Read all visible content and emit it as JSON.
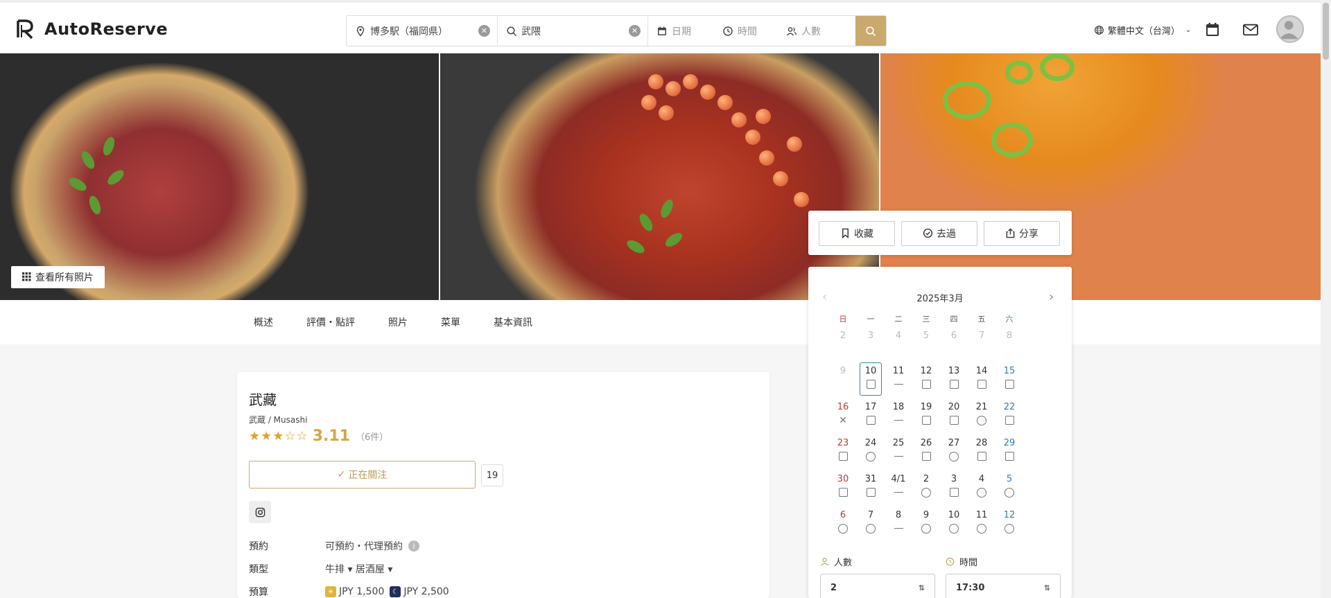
{
  "app": {
    "name": "AutoReserve"
  },
  "search": {
    "location": "博多駅（福岡県）",
    "keyword": "武隈",
    "date_placeholder": "日期",
    "time_placeholder": "時間",
    "people_placeholder": "人數"
  },
  "header": {
    "language": "繁體中文（台灣）"
  },
  "hero": {
    "view_all_photos": "查看所有照片"
  },
  "tabs": [
    {
      "label": "概述"
    },
    {
      "label": "評價・點評"
    },
    {
      "label": "照片"
    },
    {
      "label": "菜單"
    },
    {
      "label": "基本資訊"
    }
  ],
  "restaurant": {
    "name": "武藏",
    "subtitle": "武蔵 / Musashi",
    "rating": "3.11",
    "stars_filled": 3,
    "stars_total": 5,
    "review_count": "（6件）",
    "follow_label": "正在關注",
    "follow_count": "19",
    "info": [
      {
        "label": "預約",
        "value": "可預約・代理預約"
      },
      {
        "label": "類型",
        "value": "牛排 ▾ 居酒屋 ▾"
      },
      {
        "label": "預算",
        "lunch": "JPY 1,500",
        "dinner": "JPY 2,500"
      }
    ]
  },
  "actions": {
    "save": "收藏",
    "visited": "去過",
    "share": "分享"
  },
  "calendar": {
    "month_title": "2025年3月",
    "weekdays": [
      "日",
      "一",
      "二",
      "三",
      "四",
      "五",
      "六"
    ],
    "weeks": [
      [
        "2",
        "3",
        "4",
        "5",
        "6",
        "7",
        "8"
      ],
      [
        "9",
        "10",
        "11",
        "12",
        "13",
        "14",
        "15"
      ],
      [
        "16",
        "17",
        "18",
        "19",
        "20",
        "21",
        "22"
      ],
      [
        "23",
        "24",
        "25",
        "26",
        "27",
        "28",
        "29"
      ],
      [
        "30",
        "31",
        "4/1",
        "2",
        "3",
        "4",
        "5"
      ],
      [
        "6",
        "7",
        "8",
        "9",
        "10",
        "11",
        "12"
      ]
    ],
    "marks": [
      [
        "none",
        "none",
        "none",
        "none",
        "none",
        "none",
        "none"
      ],
      [
        "none",
        "box",
        "dash",
        "box",
        "box",
        "box",
        "box"
      ],
      [
        "x",
        "box",
        "dash",
        "box",
        "box",
        "circle",
        "box"
      ],
      [
        "box",
        "circle",
        "dash",
        "box",
        "circle",
        "box",
        "box"
      ],
      [
        "box",
        "box",
        "dash",
        "circle",
        "box",
        "circle",
        "circle"
      ],
      [
        "circle",
        "circle",
        "dash",
        "circle",
        "circle",
        "circle",
        "circle"
      ]
    ],
    "people_label": "人數",
    "people_value": "2",
    "time_label": "時間",
    "time_value": "17:30",
    "colors": {
      "sunday": "#c0392b",
      "saturday": "#2a7fba",
      "past": "#bbbbbb",
      "selected": "#2f8c8c"
    }
  },
  "colors": {
    "accent": "#c9a96e",
    "star": "#e1a32b"
  }
}
